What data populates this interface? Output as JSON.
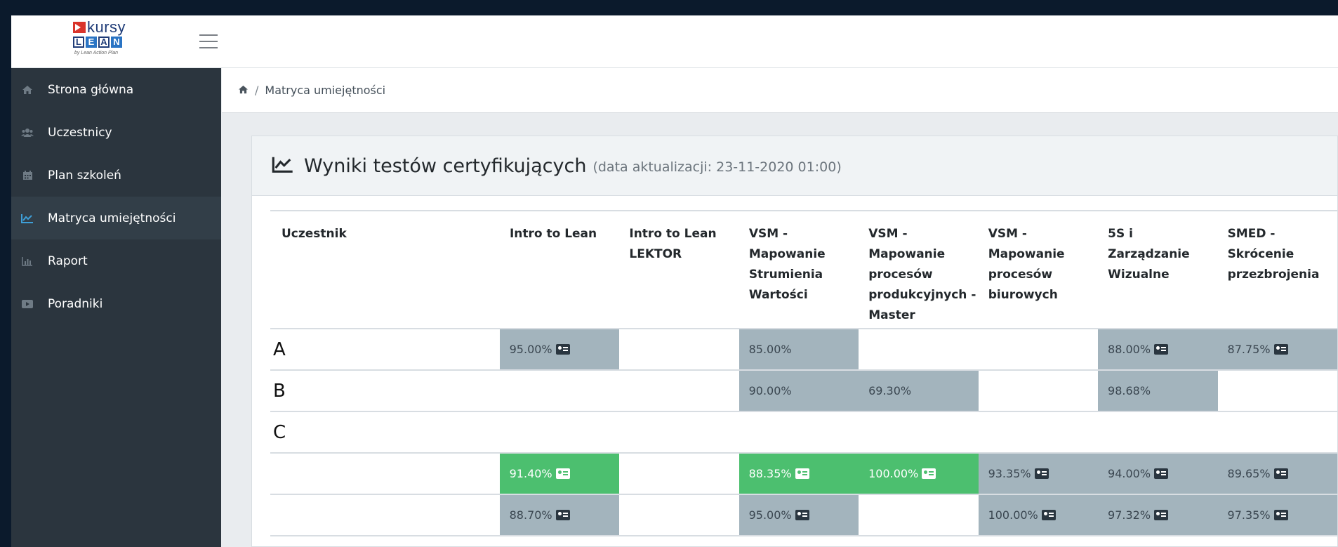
{
  "app": {
    "logo": {
      "word": "kursy",
      "letters": [
        "L",
        "E",
        "A",
        "N"
      ],
      "tagline": "by Lean Action Plan"
    }
  },
  "sidebar": {
    "items": [
      {
        "label": "Strona główna",
        "icon": "home-icon",
        "active": false
      },
      {
        "label": "Uczestnicy",
        "icon": "users-icon",
        "active": false
      },
      {
        "label": "Plan szkoleń",
        "icon": "calendar-icon",
        "active": false
      },
      {
        "label": "Matryca umiejętności",
        "icon": "line-chart-icon",
        "active": true
      },
      {
        "label": "Raport",
        "icon": "bar-chart-icon",
        "active": false
      },
      {
        "label": "Poradniki",
        "icon": "video-icon",
        "active": false
      }
    ]
  },
  "breadcrumb": {
    "home_icon": "home-icon",
    "separator": "/",
    "current": "Matryca umiejętności"
  },
  "card": {
    "title": "Wyniki testów certyfikujących",
    "subtitle": "(data aktualizacji: 23-11-2020 01:00)",
    "icon": "line-chart-icon"
  },
  "table": {
    "first_header": "Uczestnik",
    "columns": [
      "Intro to Lean",
      "Intro to Lean LEKTOR",
      "VSM - Mapowanie Strumienia Wartości",
      "VSM - Mapowanie procesów produkcyjnych - Master",
      "VSM - Mapowanie procesów biurowych",
      "5S i Zarządzanie Wizualne",
      "SMED - Skrócenie przezbrojenia"
    ],
    "rows": [
      {
        "name": "A",
        "cells": [
          {
            "value": "95.00%",
            "status": "gray",
            "cert": true
          },
          {
            "value": "",
            "status": "empty",
            "cert": false
          },
          {
            "value": "85.00%",
            "status": "gray",
            "cert": false
          },
          {
            "value": "",
            "status": "empty",
            "cert": false
          },
          {
            "value": "",
            "status": "empty",
            "cert": false
          },
          {
            "value": "88.00%",
            "status": "gray",
            "cert": true
          },
          {
            "value": "87.75%",
            "status": "gray",
            "cert": true
          }
        ]
      },
      {
        "name": "B",
        "cells": [
          {
            "value": "",
            "status": "empty",
            "cert": false
          },
          {
            "value": "",
            "status": "empty",
            "cert": false
          },
          {
            "value": "90.00%",
            "status": "gray",
            "cert": false
          },
          {
            "value": "69.30%",
            "status": "gray",
            "cert": false
          },
          {
            "value": "",
            "status": "empty",
            "cert": false
          },
          {
            "value": "98.68%",
            "status": "gray",
            "cert": false
          },
          {
            "value": "",
            "status": "empty",
            "cert": false
          }
        ]
      },
      {
        "name": "C",
        "cells": [
          {
            "value": "",
            "status": "empty",
            "cert": false
          },
          {
            "value": "",
            "status": "empty",
            "cert": false
          },
          {
            "value": "",
            "status": "empty",
            "cert": false
          },
          {
            "value": "",
            "status": "empty",
            "cert": false
          },
          {
            "value": "",
            "status": "empty",
            "cert": false
          },
          {
            "value": "",
            "status": "empty",
            "cert": false
          },
          {
            "value": "",
            "status": "empty",
            "cert": false
          }
        ]
      },
      {
        "name": "",
        "cells": [
          {
            "value": "91.40%",
            "status": "green",
            "cert": true
          },
          {
            "value": "",
            "status": "empty",
            "cert": false
          },
          {
            "value": "88.35%",
            "status": "green",
            "cert": true
          },
          {
            "value": "100.00%",
            "status": "green",
            "cert": true
          },
          {
            "value": "93.35%",
            "status": "gray",
            "cert": true
          },
          {
            "value": "94.00%",
            "status": "gray",
            "cert": true
          },
          {
            "value": "89.65%",
            "status": "gray",
            "cert": true
          }
        ]
      },
      {
        "name": "",
        "cells": [
          {
            "value": "88.70%",
            "status": "gray",
            "cert": true
          },
          {
            "value": "",
            "status": "empty",
            "cert": false
          },
          {
            "value": "95.00%",
            "status": "gray",
            "cert": true
          },
          {
            "value": "",
            "status": "empty",
            "cert": false
          },
          {
            "value": "100.00%",
            "status": "gray",
            "cert": true
          },
          {
            "value": "97.32%",
            "status": "gray",
            "cert": true
          },
          {
            "value": "97.35%",
            "status": "gray",
            "cert": true
          }
        ]
      }
    ]
  },
  "colors": {
    "sidebar_bg": "#2b353e",
    "sidebar_active": "#323e48",
    "cell_gray": "#a3b4bd",
    "cell_green": "#4cbf6f"
  }
}
